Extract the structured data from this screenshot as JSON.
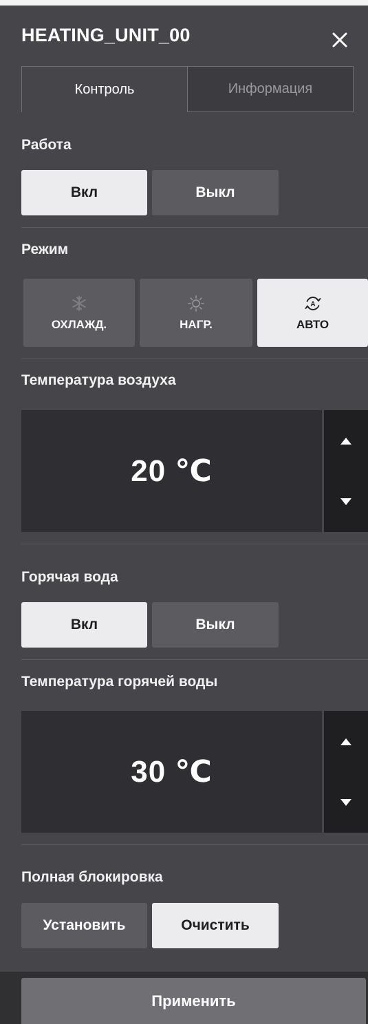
{
  "header": {
    "title": "HEATING_UNIT_00",
    "close_icon": "close-icon"
  },
  "tabs": [
    {
      "label": "Контроль",
      "active": true
    },
    {
      "label": "Информация",
      "active": false
    }
  ],
  "operation": {
    "label": "Работа",
    "on_label": "Вкл",
    "off_label": "Выкл",
    "selected": "Вкл"
  },
  "mode": {
    "label": "Режим",
    "options": [
      {
        "label": "ОХЛАЖД.",
        "icon": "snowflake-icon",
        "selected": false
      },
      {
        "label": "НАГР.",
        "icon": "sun-icon",
        "selected": false
      },
      {
        "label": "АВТО",
        "icon": "auto-cycle-icon",
        "selected": true
      }
    ]
  },
  "air_temp": {
    "label": "Температура воздуха",
    "value": "20 ℃"
  },
  "hot_water": {
    "label": "Горячая вода",
    "on_label": "Вкл",
    "off_label": "Выкл",
    "selected": "Вкл"
  },
  "water_temp": {
    "label": "Температура горячей воды",
    "value": "30 ℃"
  },
  "lock": {
    "label": "Полная блокировка",
    "set_label": "Установить",
    "clear_label": "Очистить",
    "selected": "Очистить"
  },
  "apply": {
    "label": "Применить"
  },
  "colors": {
    "panel_bg": "#46464a",
    "selected_button": "#ececef",
    "unselected_button": "#5b5b60",
    "display_bg": "#2f2f33",
    "stepper_bg": "#1f1f22",
    "apply_button": "#6f6f74"
  }
}
